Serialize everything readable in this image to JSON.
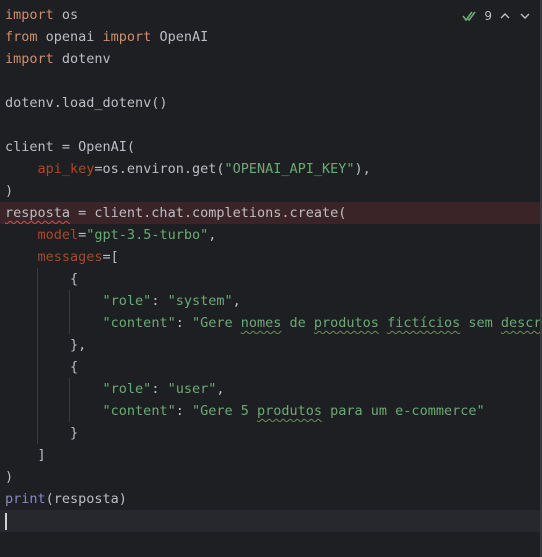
{
  "inspection_widget": {
    "count": "9",
    "icon": "double-check-icon",
    "accent_color": "#6aab73"
  },
  "lines": {
    "l1": {
      "kw": "import",
      "rest": " os"
    },
    "l2": {
      "kw1": "from",
      "mid": " openai ",
      "kw2": "import",
      "rest": " OpenAI"
    },
    "l3": {
      "kw": "import",
      "rest": " dotenv"
    },
    "l5": {
      "text": "dotenv.load_dotenv()"
    },
    "l7": {
      "text": "client = OpenAI("
    },
    "l8": {
      "indent": "    ",
      "param": "api_key",
      "mid": "=os.environ.get(",
      "str": "\"OPENAI_API_KEY\"",
      "end": "),"
    },
    "l9": {
      "text": ")"
    },
    "l10": {
      "var": "resposta",
      "rest": " = client.chat.completions.create("
    },
    "l11": {
      "indent": "    ",
      "param": "model",
      "mid": "=",
      "str": "\"gpt-3.5-turbo\"",
      "end": ","
    },
    "l12": {
      "indent": "    ",
      "param": "messages",
      "rest": "=["
    },
    "l13": {
      "indent": "        ",
      "text": "{"
    },
    "l14": {
      "indent": "            ",
      "str1": "\"role\"",
      "mid": ": ",
      "str2": "\"system\"",
      "end": ","
    },
    "l15": {
      "indent": "            ",
      "str1": "\"content\"",
      "mid": ": ",
      "s_a": "\"Gere ",
      "s_w1": "nomes",
      "s_b": " de ",
      "s_w2": "produtos",
      "s_c": " ",
      "s_w3": "fictícios",
      "s_d": " sem ",
      "s_w4": "descrição\""
    },
    "l16": {
      "indent": "        ",
      "text": "},"
    },
    "l17": {
      "indent": "        ",
      "text": "{"
    },
    "l18": {
      "indent": "            ",
      "str1": "\"role\"",
      "mid": ": ",
      "str2": "\"user\"",
      "end": ","
    },
    "l19": {
      "indent": "            ",
      "str1": "\"content\"",
      "mid": ": ",
      "s_a": "\"Gere 5 ",
      "s_w1": "produtos",
      "s_b": " para um e-commerce\""
    },
    "l20": {
      "indent": "        ",
      "text": "}"
    },
    "l21": {
      "indent": "    ",
      "text": "]"
    },
    "l22": {
      "text": ")"
    },
    "l23": {
      "fn": "print",
      "rest": "(resposta)"
    }
  }
}
